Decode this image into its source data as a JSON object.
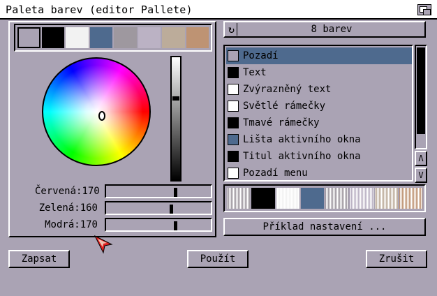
{
  "window": {
    "title": "Paleta barev (editor Pallete)"
  },
  "palette": {
    "swatches": [
      "#aaa3b4",
      "#000000",
      "#f2f2f2",
      "#4e6a8e",
      "#9e989f",
      "#bbb2c4",
      "#bcac9a",
      "#be9373"
    ],
    "selected_index": 0
  },
  "sliders": [
    {
      "label": "Červená:",
      "value": "170",
      "level": 0.667
    },
    {
      "label": "Zelená:",
      "value": "160",
      "level": 0.627
    },
    {
      "label": "Modrá:",
      "value": "170",
      "level": 0.667
    }
  ],
  "colors_selector": {
    "label": "8 barev",
    "icon": "cycle-icon"
  },
  "list": {
    "items": [
      {
        "label": "Pozadí",
        "color": "#aaa3b4",
        "selected": true
      },
      {
        "label": "Text",
        "color": "#000000",
        "selected": false
      },
      {
        "label": "Zvýrazněný text",
        "color": "#ffffff",
        "selected": false
      },
      {
        "label": "Světlé rámečky",
        "color": "#ffffff",
        "selected": false
      },
      {
        "label": "Tmavé rámečky",
        "color": "#000000",
        "selected": false
      },
      {
        "label": "Lišta aktivního okna",
        "color": "#4e6a8e",
        "selected": false
      },
      {
        "label": "Titul aktivního okna",
        "color": "#000000",
        "selected": false
      },
      {
        "label": "Pozadí menu",
        "color": "#ffffff",
        "selected": false
      }
    ],
    "arrow_up": "Λ",
    "arrow_down": "V"
  },
  "preview_patterns": [
    "#9e989f",
    "#000000",
    "#f2f2f2",
    "#4e6a8e",
    "#9e989f",
    "#bbb2c4",
    "#bcac9a",
    "#be9373"
  ],
  "buttons": {
    "example": "Příklad nastavení ...",
    "save": "Zapsat",
    "use": "Použít",
    "cancel": "Zrušit"
  }
}
